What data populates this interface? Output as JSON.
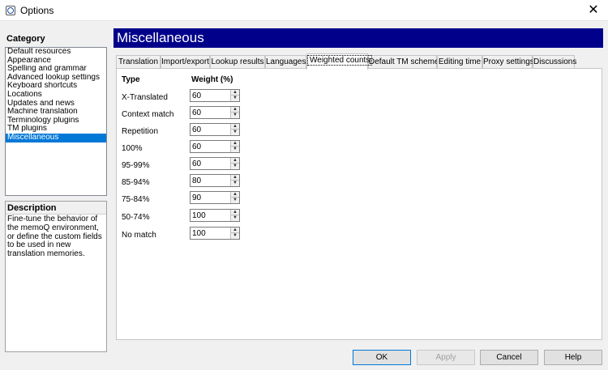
{
  "window": {
    "title": "Options",
    "close_glyph": "✕"
  },
  "category": {
    "label": "Category",
    "items": [
      "Default resources",
      "Appearance",
      "Spelling and grammar",
      "Advanced lookup settings",
      "Keyboard shortcuts",
      "Locations",
      "Updates and news",
      "Machine translation",
      "Terminology plugins",
      "TM plugins",
      "Miscellaneous"
    ],
    "selected_index": 10
  },
  "description": {
    "label": "Description",
    "text": "Fine-tune the behavior of the memoQ environment, or define the custom fields to be used in new translation memories."
  },
  "panel": {
    "title": "Miscellaneous"
  },
  "tabs": [
    "Translation",
    "Import/export",
    "Lookup results",
    "Languages",
    "Weighted counts",
    "Default TM scheme",
    "Editing time",
    "Proxy settings",
    "Discussions"
  ],
  "active_tab_index": 4,
  "weights": {
    "col_type": "Type",
    "col_weight": "Weight (%)",
    "rows": [
      {
        "type": "X-Translated",
        "weight": "60"
      },
      {
        "type": "Context match",
        "weight": "60"
      },
      {
        "type": "Repetition",
        "weight": "60"
      },
      {
        "type": "100%",
        "weight": "60"
      },
      {
        "type": "95-99%",
        "weight": "60"
      },
      {
        "type": "85-94%",
        "weight": "80"
      },
      {
        "type": "75-84%",
        "weight": "90"
      },
      {
        "type": "50-74%",
        "weight": "100"
      },
      {
        "type": "No match",
        "weight": "100"
      }
    ]
  },
  "buttons": {
    "ok": "OK",
    "apply": "Apply",
    "cancel": "Cancel",
    "help": "Help"
  },
  "colors": {
    "header_bg": "#00008b",
    "selection": "#0078d7"
  }
}
